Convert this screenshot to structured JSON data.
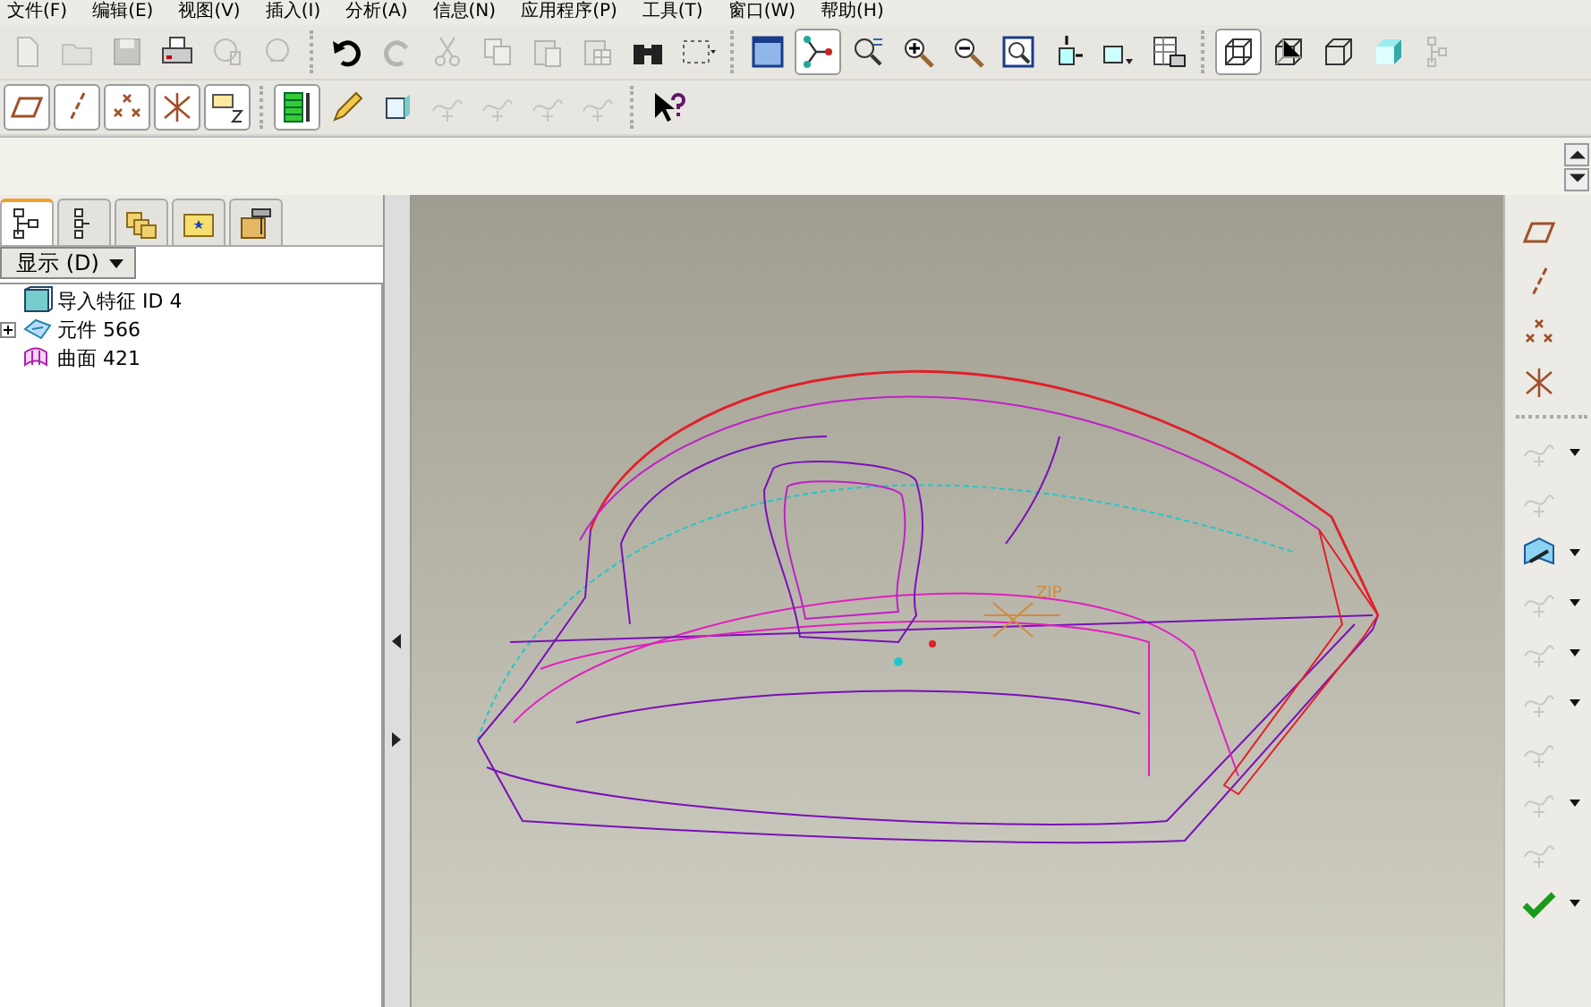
{
  "menu": [
    "文件(F)",
    "编辑(E)",
    "视图(V)",
    "插入(I)",
    "分析(A)",
    "信息(N)",
    "应用程序(P)",
    "工具(T)",
    "窗口(W)",
    "帮助(H)"
  ],
  "toolbar_top": [
    {
      "kind": "new",
      "disabled": true,
      "selected": false
    },
    {
      "kind": "open",
      "disabled": true,
      "selected": false
    },
    {
      "kind": "save",
      "disabled": true,
      "selected": false
    },
    {
      "kind": "print",
      "disabled": false,
      "selected": false
    },
    {
      "kind": "sendmail",
      "disabled": true,
      "selected": false
    },
    {
      "kind": "sendlink",
      "disabled": true,
      "selected": false
    },
    {
      "kind": "sep"
    },
    {
      "kind": "undo",
      "disabled": false,
      "selected": false
    },
    {
      "kind": "redo",
      "disabled": true,
      "selected": false
    },
    {
      "kind": "cut",
      "disabled": true,
      "selected": false
    },
    {
      "kind": "copy",
      "disabled": true,
      "selected": false
    },
    {
      "kind": "paste",
      "disabled": true,
      "selected": false
    },
    {
      "kind": "pastespecial",
      "disabled": true,
      "selected": false
    },
    {
      "kind": "find",
      "disabled": false,
      "selected": false
    },
    {
      "kind": "selectbox",
      "disabled": false,
      "selected": false
    },
    {
      "kind": "sep"
    },
    {
      "kind": "redraw",
      "disabled": false,
      "selected": false
    },
    {
      "kind": "spin",
      "disabled": false,
      "selected": true
    },
    {
      "kind": "orient",
      "disabled": false,
      "selected": false
    },
    {
      "kind": "zoomin",
      "disabled": false,
      "selected": false
    },
    {
      "kind": "zoomout",
      "disabled": false,
      "selected": false
    },
    {
      "kind": "refit",
      "disabled": false,
      "selected": false
    },
    {
      "kind": "reorient",
      "disabled": false,
      "selected": false
    },
    {
      "kind": "views",
      "disabled": false,
      "selected": false
    },
    {
      "kind": "layers",
      "disabled": false,
      "selected": false
    },
    {
      "kind": "sep"
    },
    {
      "kind": "wireframe",
      "disabled": false,
      "selected": true
    },
    {
      "kind": "hidden",
      "disabled": false,
      "selected": false
    },
    {
      "kind": "nohidden",
      "disabled": false,
      "selected": false
    },
    {
      "kind": "shaded",
      "disabled": false,
      "selected": false
    },
    {
      "kind": "tree",
      "disabled": true,
      "selected": false
    }
  ],
  "toolbar_second": [
    {
      "kind": "planes",
      "disabled": false,
      "selected": true
    },
    {
      "kind": "axes",
      "disabled": false,
      "selected": true
    },
    {
      "kind": "points",
      "disabled": false,
      "selected": true
    },
    {
      "kind": "csys",
      "disabled": false,
      "selected": true
    },
    {
      "kind": "notes",
      "disabled": false,
      "selected": true
    },
    {
      "kind": "sep"
    },
    {
      "kind": "spool",
      "disabled": false,
      "selected": true
    },
    {
      "kind": "pencil",
      "disabled": false,
      "selected": false
    },
    {
      "kind": "box",
      "disabled": false,
      "selected": false
    },
    {
      "kind": "curve",
      "disabled": true,
      "selected": false
    },
    {
      "kind": "curve",
      "disabled": true,
      "selected": false
    },
    {
      "kind": "curve",
      "disabled": true,
      "selected": false
    },
    {
      "kind": "curve",
      "disabled": true,
      "selected": false
    },
    {
      "kind": "sep"
    },
    {
      "kind": "helpcursor",
      "disabled": false,
      "selected": false
    }
  ],
  "navigator": {
    "tabs": [
      {
        "kind": "tree",
        "selected": true
      },
      {
        "kind": "layers",
        "selected": false
      },
      {
        "kind": "folders",
        "selected": false
      },
      {
        "kind": "favorites",
        "selected": false
      },
      {
        "kind": "tools",
        "selected": false
      }
    ],
    "display_button": "显示 (D)",
    "tree": [
      {
        "kind": "feature",
        "label": "导入特征 ID 4"
      },
      {
        "kind": "part",
        "label": "元件 566",
        "expanded": false
      },
      {
        "kind": "surface",
        "label": "曲面 421"
      }
    ]
  },
  "viewport": {
    "csys_label": "ZIP"
  },
  "right_toolbar": [
    {
      "kind": "planes",
      "disabled": false,
      "dropdown": false
    },
    {
      "kind": "axes",
      "disabled": false,
      "dropdown": false
    },
    {
      "kind": "points",
      "disabled": false,
      "dropdown": false
    },
    {
      "kind": "csys",
      "disabled": false,
      "dropdown": false
    },
    {
      "kind": "sep"
    },
    {
      "kind": "curve",
      "disabled": true,
      "dropdown": true
    },
    {
      "kind": "curve",
      "disabled": true,
      "dropdown": false
    },
    {
      "kind": "surface",
      "disabled": false,
      "dropdown": true
    },
    {
      "kind": "curve",
      "disabled": true,
      "dropdown": true
    },
    {
      "kind": "curve",
      "disabled": true,
      "dropdown": true
    },
    {
      "kind": "curve",
      "disabled": true,
      "dropdown": true
    },
    {
      "kind": "curve",
      "disabled": true,
      "dropdown": false
    },
    {
      "kind": "curve",
      "disabled": true,
      "dropdown": true
    },
    {
      "kind": "curve",
      "disabled": true,
      "dropdown": false
    },
    {
      "kind": "check",
      "disabled": false,
      "dropdown": true
    }
  ]
}
